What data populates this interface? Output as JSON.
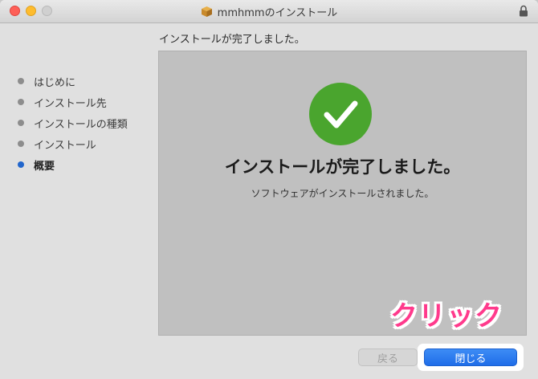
{
  "window": {
    "title": "mmhmmのインストール"
  },
  "heading": "インストールが完了しました。",
  "steps": [
    {
      "label": "はじめに",
      "active": false
    },
    {
      "label": "インストール先",
      "active": false
    },
    {
      "label": "インストールの種類",
      "active": false
    },
    {
      "label": "インストール",
      "active": false
    },
    {
      "label": "概要",
      "active": true
    }
  ],
  "content": {
    "title": "インストールが完了しました。",
    "subtitle": "ソフトウェアがインストールされました。"
  },
  "buttons": {
    "back": "戻る",
    "close": "閉じる"
  },
  "annotation": "クリック",
  "colors": {
    "success": "#4aa52e",
    "accent": "#2266cc",
    "annotation": "#ff3a8c"
  }
}
